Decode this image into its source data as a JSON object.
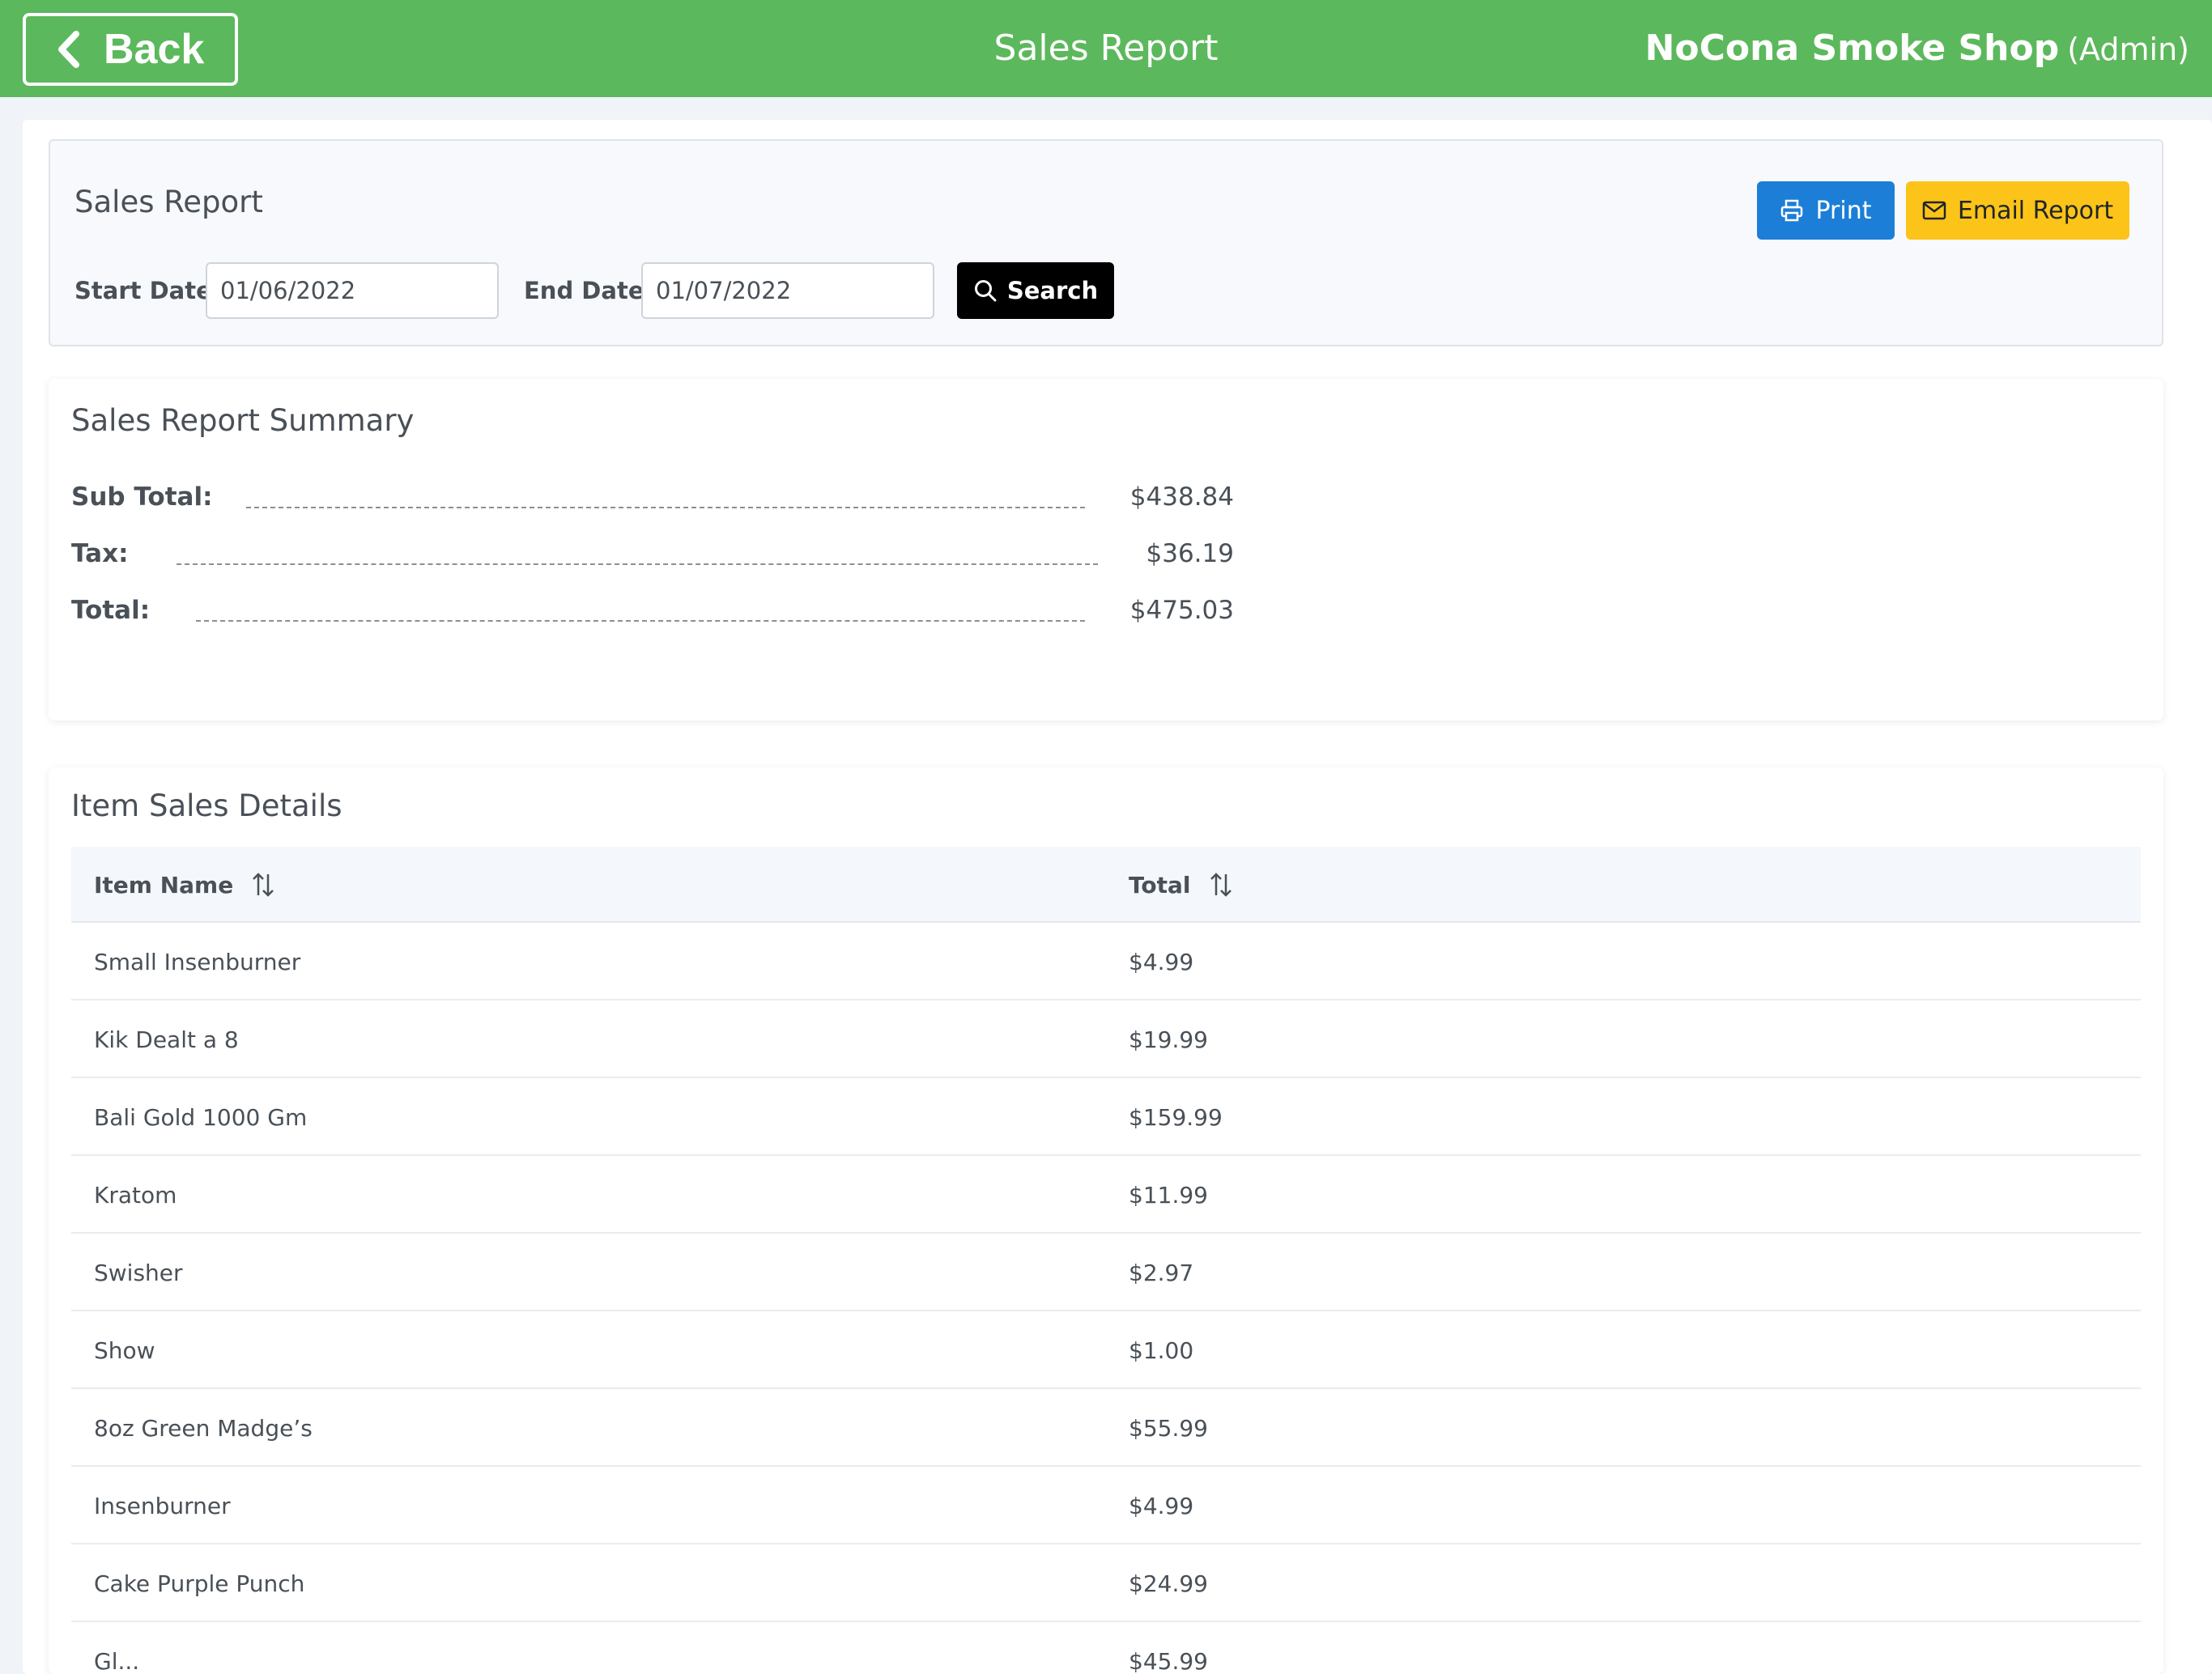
{
  "header": {
    "back_label": "Back",
    "title": "Sales Report",
    "shop_name": "NoCona Smoke Shop",
    "role": "(Admin)",
    "color": "#5cb85c"
  },
  "filter": {
    "title": "Sales Report",
    "start_label": "Start Date:",
    "start_value": "01/06/2022",
    "end_label": "End Date:",
    "end_value": "01/07/2022",
    "search_label": "Search",
    "print_label": "Print",
    "email_label": "Email Report"
  },
  "summary": {
    "title": "Sales Report Summary",
    "rows": [
      {
        "label": "Sub Total:",
        "value": "$438.84"
      },
      {
        "label": "Tax:",
        "value": "$36.19"
      },
      {
        "label": "Total:",
        "value": "$475.03"
      }
    ]
  },
  "details": {
    "title": "Item Sales Details",
    "columns": [
      "Item Name",
      "Total"
    ],
    "rows": [
      {
        "name": "Small Insenburner",
        "total": "$4.99"
      },
      {
        "name": "Kik Dealt a 8",
        "total": "$19.99"
      },
      {
        "name": "Bali Gold 1000 Gm",
        "total": "$159.99"
      },
      {
        "name": "Kratom",
        "total": "$11.99"
      },
      {
        "name": "Swisher",
        "total": "$2.97"
      },
      {
        "name": "Show",
        "total": "$1.00"
      },
      {
        "name": "8oz Green Madge’s",
        "total": "$55.99"
      },
      {
        "name": "Insenburner",
        "total": "$4.99"
      },
      {
        "name": "Cake Purple Punch",
        "total": "$24.99"
      },
      {
        "name": "Gl...",
        "total": "$45.99"
      }
    ]
  },
  "colors": {
    "print": "#1c7ed6",
    "email": "#fcc419",
    "search": "#000000"
  },
  "icons": [
    "chevron-left-icon",
    "search-icon",
    "printer-icon",
    "mail-icon",
    "sort-icon"
  ]
}
